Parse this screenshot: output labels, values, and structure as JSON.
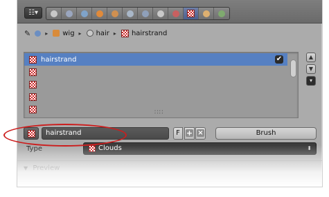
{
  "header": {
    "editor_type_icon": "editor-type-menu-icon",
    "context_tabs": [
      {
        "name": "render-icon",
        "color": "#c8c8c8"
      },
      {
        "name": "render-layers-icon",
        "color": "#9aa6bf"
      },
      {
        "name": "scene-icon",
        "color": "#7fa3c9"
      },
      {
        "name": "world-icon",
        "color": "#e08a3a"
      },
      {
        "name": "object-icon",
        "color": "#d09050"
      },
      {
        "name": "constraints-icon",
        "color": "#a9b7c8"
      },
      {
        "name": "modifiers-icon",
        "color": "#8fa0ba"
      },
      {
        "name": "data-icon",
        "color": "#c9c9c9"
      },
      {
        "name": "material-icon",
        "color": "#c86060"
      },
      {
        "name": "texture-icon",
        "color": "#d23030"
      },
      {
        "name": "particles-icon",
        "color": "#ddb070"
      },
      {
        "name": "physics-icon",
        "color": "#7faa6f"
      }
    ],
    "active_tab": 9
  },
  "breadcrumb": {
    "items": [
      {
        "label": "wig",
        "icon": "object-cube-icon"
      },
      {
        "label": "hair",
        "icon": "particle-system-icon"
      },
      {
        "label": "hairstrand",
        "icon": "texture-icon"
      }
    ]
  },
  "texture_slots": {
    "selected_label": "hairstrand",
    "items": [
      "hairstrand",
      "",
      "",
      "",
      ""
    ],
    "selected_index": 0,
    "checked": "✔"
  },
  "side_buttons": [
    "▲",
    "▼",
    "▾"
  ],
  "texture_row": {
    "name": "hairstrand",
    "fake_user": "F",
    "add": "+",
    "remove": "×",
    "brush_label": "Brush"
  },
  "type": {
    "label": "Type",
    "value": "Clouds",
    "arrows": "⬍"
  },
  "preview": {
    "label": "Preview"
  },
  "colors": {
    "accent": "#5680c2",
    "highlight_ellipse": "#cc1e1e"
  }
}
